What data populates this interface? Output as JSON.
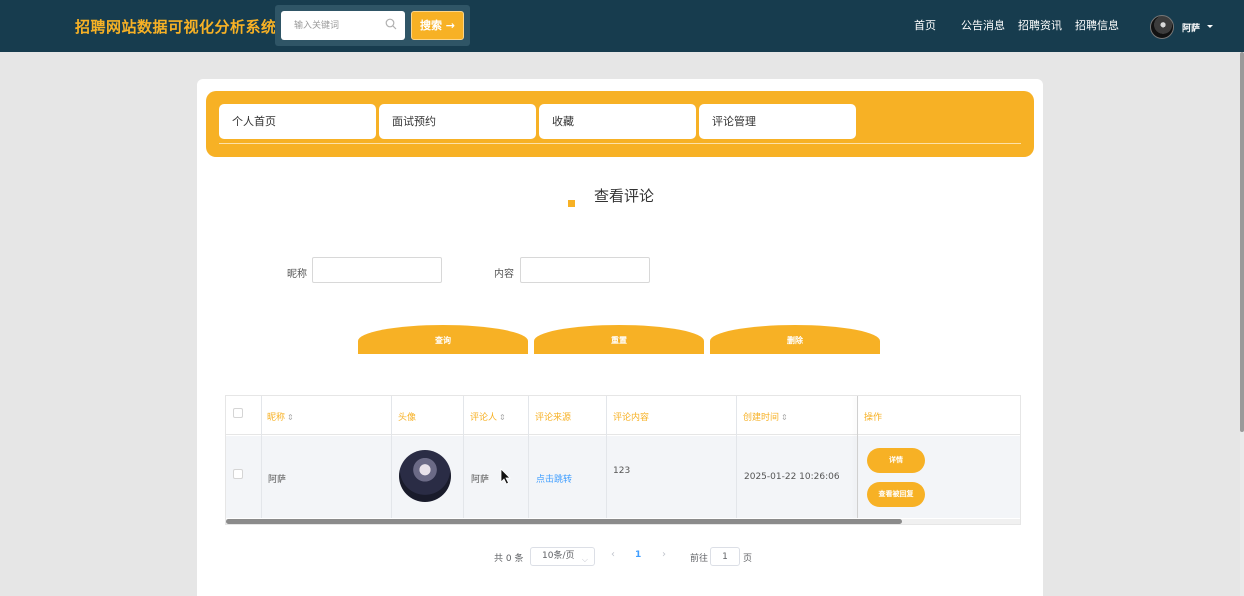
{
  "header": {
    "brand": "招聘网站数据可视化分析系统",
    "search_placeholder": "输入关键词",
    "search_button": "搜索 →",
    "nav": [
      "首页",
      "公告消息",
      "招聘资讯",
      "招聘信息"
    ],
    "user_name": "阿萨",
    "brand_color": "#f7b125",
    "bar_color": "#173c4e"
  },
  "tabs": [
    "个人首页",
    "面试预约",
    "收藏",
    "评论管理"
  ],
  "section_title": "查看评论",
  "filters": {
    "nickname_label": "昵称",
    "nickname_value": "",
    "content_label": "内容",
    "content_value": ""
  },
  "actions": [
    "查询",
    "重置",
    "删除"
  ],
  "table": {
    "columns": [
      "昵称",
      "头像",
      "评论人",
      "评论来源",
      "评论内容",
      "创建时间",
      "操作"
    ],
    "rows": [
      {
        "nickname": "阿萨",
        "commenter": "阿萨",
        "source": "点击跳转",
        "content": "123",
        "created": "2025-01-22 10:26:06",
        "op_detail": "详情",
        "op_reply": "查看被回复"
      }
    ]
  },
  "pagination": {
    "total": "共 0 条",
    "page_size": "10条/页",
    "current_page": "1",
    "goto_label": "前往",
    "goto_value": "1",
    "page_unit": "页"
  }
}
